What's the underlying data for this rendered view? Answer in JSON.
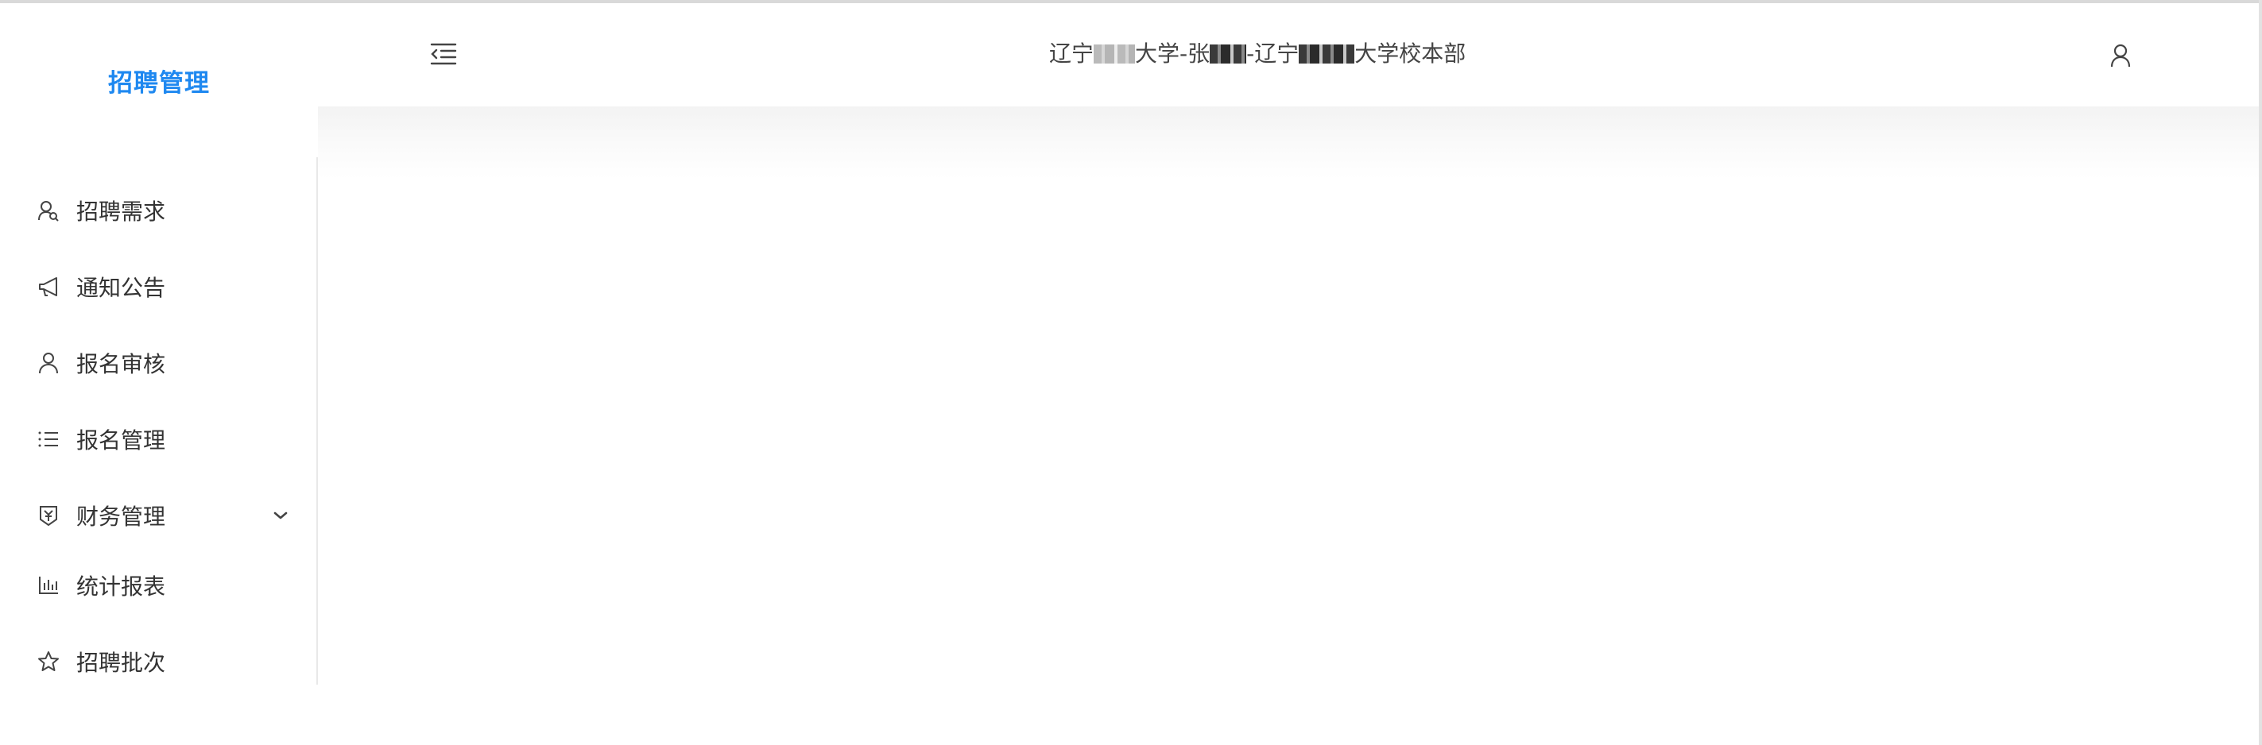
{
  "app": {
    "logo_title": "招聘管理"
  },
  "header": {
    "org_part1": "辽宁",
    "org_part2": "大学-张",
    "org_part3": "-辽宁",
    "org_part4": "大学校本部"
  },
  "sidebar": {
    "items": [
      {
        "label": "招聘需求",
        "icon": "recruit-user-icon"
      },
      {
        "label": "通知公告",
        "icon": "megaphone-icon"
      },
      {
        "label": "报名审核",
        "icon": "user-icon"
      },
      {
        "label": "报名管理",
        "icon": "list-icon"
      },
      {
        "label": "财务管理",
        "icon": "yuan-shield-icon",
        "has_submenu": true
      },
      {
        "label": "统计报表",
        "icon": "bar-chart-icon"
      },
      {
        "label": "招聘批次",
        "icon": "star-icon"
      }
    ]
  },
  "colors": {
    "brand": "#1e88f0",
    "text": "#333333"
  }
}
